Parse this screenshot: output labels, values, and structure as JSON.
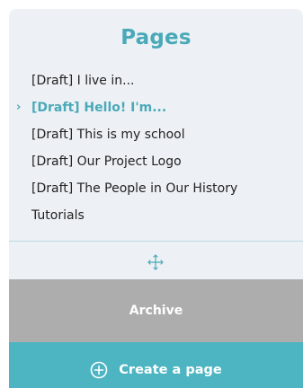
{
  "panel": {
    "title": "Pages"
  },
  "pages": {
    "items": [
      {
        "label": "[Draft] I live in...",
        "active": false
      },
      {
        "label": "[Draft] Hello! I'm...",
        "active": true
      },
      {
        "label": "[Draft] This is my school",
        "active": false
      },
      {
        "label": "[Draft] Our Project Logo",
        "active": false
      },
      {
        "label": "[Draft] The People in Our History",
        "active": false
      },
      {
        "label": "Tutorials",
        "active": false
      }
    ],
    "active_marker": "›"
  },
  "buttons": {
    "archive_label": "Archive",
    "create_label": "Create a page"
  },
  "icons": {
    "drag": "move-arrows-icon",
    "create": "plus-circle-icon"
  },
  "colors": {
    "accent": "#4aa9b8",
    "panel_bg": "#edf1f5",
    "archive_bg": "#adadad",
    "create_bg": "#4db5c2"
  }
}
